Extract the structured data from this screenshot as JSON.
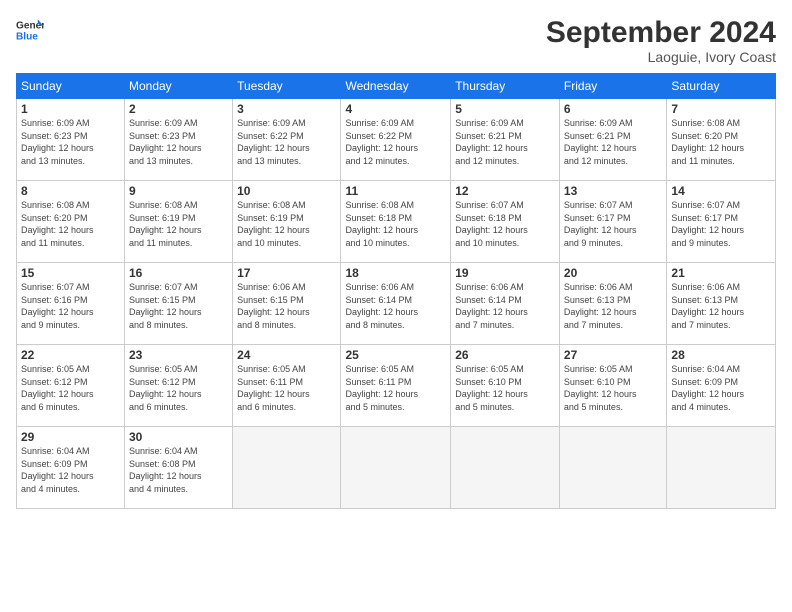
{
  "header": {
    "logo_line1": "General",
    "logo_line2": "Blue",
    "month_title": "September 2024",
    "location": "Laoguie, Ivory Coast"
  },
  "weekdays": [
    "Sunday",
    "Monday",
    "Tuesday",
    "Wednesday",
    "Thursday",
    "Friday",
    "Saturday"
  ],
  "weeks": [
    [
      {
        "day": "1",
        "info": "Sunrise: 6:09 AM\nSunset: 6:23 PM\nDaylight: 12 hours\nand 13 minutes."
      },
      {
        "day": "2",
        "info": "Sunrise: 6:09 AM\nSunset: 6:23 PM\nDaylight: 12 hours\nand 13 minutes."
      },
      {
        "day": "3",
        "info": "Sunrise: 6:09 AM\nSunset: 6:22 PM\nDaylight: 12 hours\nand 13 minutes."
      },
      {
        "day": "4",
        "info": "Sunrise: 6:09 AM\nSunset: 6:22 PM\nDaylight: 12 hours\nand 12 minutes."
      },
      {
        "day": "5",
        "info": "Sunrise: 6:09 AM\nSunset: 6:21 PM\nDaylight: 12 hours\nand 12 minutes."
      },
      {
        "day": "6",
        "info": "Sunrise: 6:09 AM\nSunset: 6:21 PM\nDaylight: 12 hours\nand 12 minutes."
      },
      {
        "day": "7",
        "info": "Sunrise: 6:08 AM\nSunset: 6:20 PM\nDaylight: 12 hours\nand 11 minutes."
      }
    ],
    [
      {
        "day": "8",
        "info": "Sunrise: 6:08 AM\nSunset: 6:20 PM\nDaylight: 12 hours\nand 11 minutes."
      },
      {
        "day": "9",
        "info": "Sunrise: 6:08 AM\nSunset: 6:19 PM\nDaylight: 12 hours\nand 11 minutes."
      },
      {
        "day": "10",
        "info": "Sunrise: 6:08 AM\nSunset: 6:19 PM\nDaylight: 12 hours\nand 10 minutes."
      },
      {
        "day": "11",
        "info": "Sunrise: 6:08 AM\nSunset: 6:18 PM\nDaylight: 12 hours\nand 10 minutes."
      },
      {
        "day": "12",
        "info": "Sunrise: 6:07 AM\nSunset: 6:18 PM\nDaylight: 12 hours\nand 10 minutes."
      },
      {
        "day": "13",
        "info": "Sunrise: 6:07 AM\nSunset: 6:17 PM\nDaylight: 12 hours\nand 9 minutes."
      },
      {
        "day": "14",
        "info": "Sunrise: 6:07 AM\nSunset: 6:17 PM\nDaylight: 12 hours\nand 9 minutes."
      }
    ],
    [
      {
        "day": "15",
        "info": "Sunrise: 6:07 AM\nSunset: 6:16 PM\nDaylight: 12 hours\nand 9 minutes."
      },
      {
        "day": "16",
        "info": "Sunrise: 6:07 AM\nSunset: 6:15 PM\nDaylight: 12 hours\nand 8 minutes."
      },
      {
        "day": "17",
        "info": "Sunrise: 6:06 AM\nSunset: 6:15 PM\nDaylight: 12 hours\nand 8 minutes."
      },
      {
        "day": "18",
        "info": "Sunrise: 6:06 AM\nSunset: 6:14 PM\nDaylight: 12 hours\nand 8 minutes."
      },
      {
        "day": "19",
        "info": "Sunrise: 6:06 AM\nSunset: 6:14 PM\nDaylight: 12 hours\nand 7 minutes."
      },
      {
        "day": "20",
        "info": "Sunrise: 6:06 AM\nSunset: 6:13 PM\nDaylight: 12 hours\nand 7 minutes."
      },
      {
        "day": "21",
        "info": "Sunrise: 6:06 AM\nSunset: 6:13 PM\nDaylight: 12 hours\nand 7 minutes."
      }
    ],
    [
      {
        "day": "22",
        "info": "Sunrise: 6:05 AM\nSunset: 6:12 PM\nDaylight: 12 hours\nand 6 minutes."
      },
      {
        "day": "23",
        "info": "Sunrise: 6:05 AM\nSunset: 6:12 PM\nDaylight: 12 hours\nand 6 minutes."
      },
      {
        "day": "24",
        "info": "Sunrise: 6:05 AM\nSunset: 6:11 PM\nDaylight: 12 hours\nand 6 minutes."
      },
      {
        "day": "25",
        "info": "Sunrise: 6:05 AM\nSunset: 6:11 PM\nDaylight: 12 hours\nand 5 minutes."
      },
      {
        "day": "26",
        "info": "Sunrise: 6:05 AM\nSunset: 6:10 PM\nDaylight: 12 hours\nand 5 minutes."
      },
      {
        "day": "27",
        "info": "Sunrise: 6:05 AM\nSunset: 6:10 PM\nDaylight: 12 hours\nand 5 minutes."
      },
      {
        "day": "28",
        "info": "Sunrise: 6:04 AM\nSunset: 6:09 PM\nDaylight: 12 hours\nand 4 minutes."
      }
    ],
    [
      {
        "day": "29",
        "info": "Sunrise: 6:04 AM\nSunset: 6:09 PM\nDaylight: 12 hours\nand 4 minutes."
      },
      {
        "day": "30",
        "info": "Sunrise: 6:04 AM\nSunset: 6:08 PM\nDaylight: 12 hours\nand 4 minutes."
      },
      {
        "day": "",
        "info": ""
      },
      {
        "day": "",
        "info": ""
      },
      {
        "day": "",
        "info": ""
      },
      {
        "day": "",
        "info": ""
      },
      {
        "day": "",
        "info": ""
      }
    ]
  ]
}
